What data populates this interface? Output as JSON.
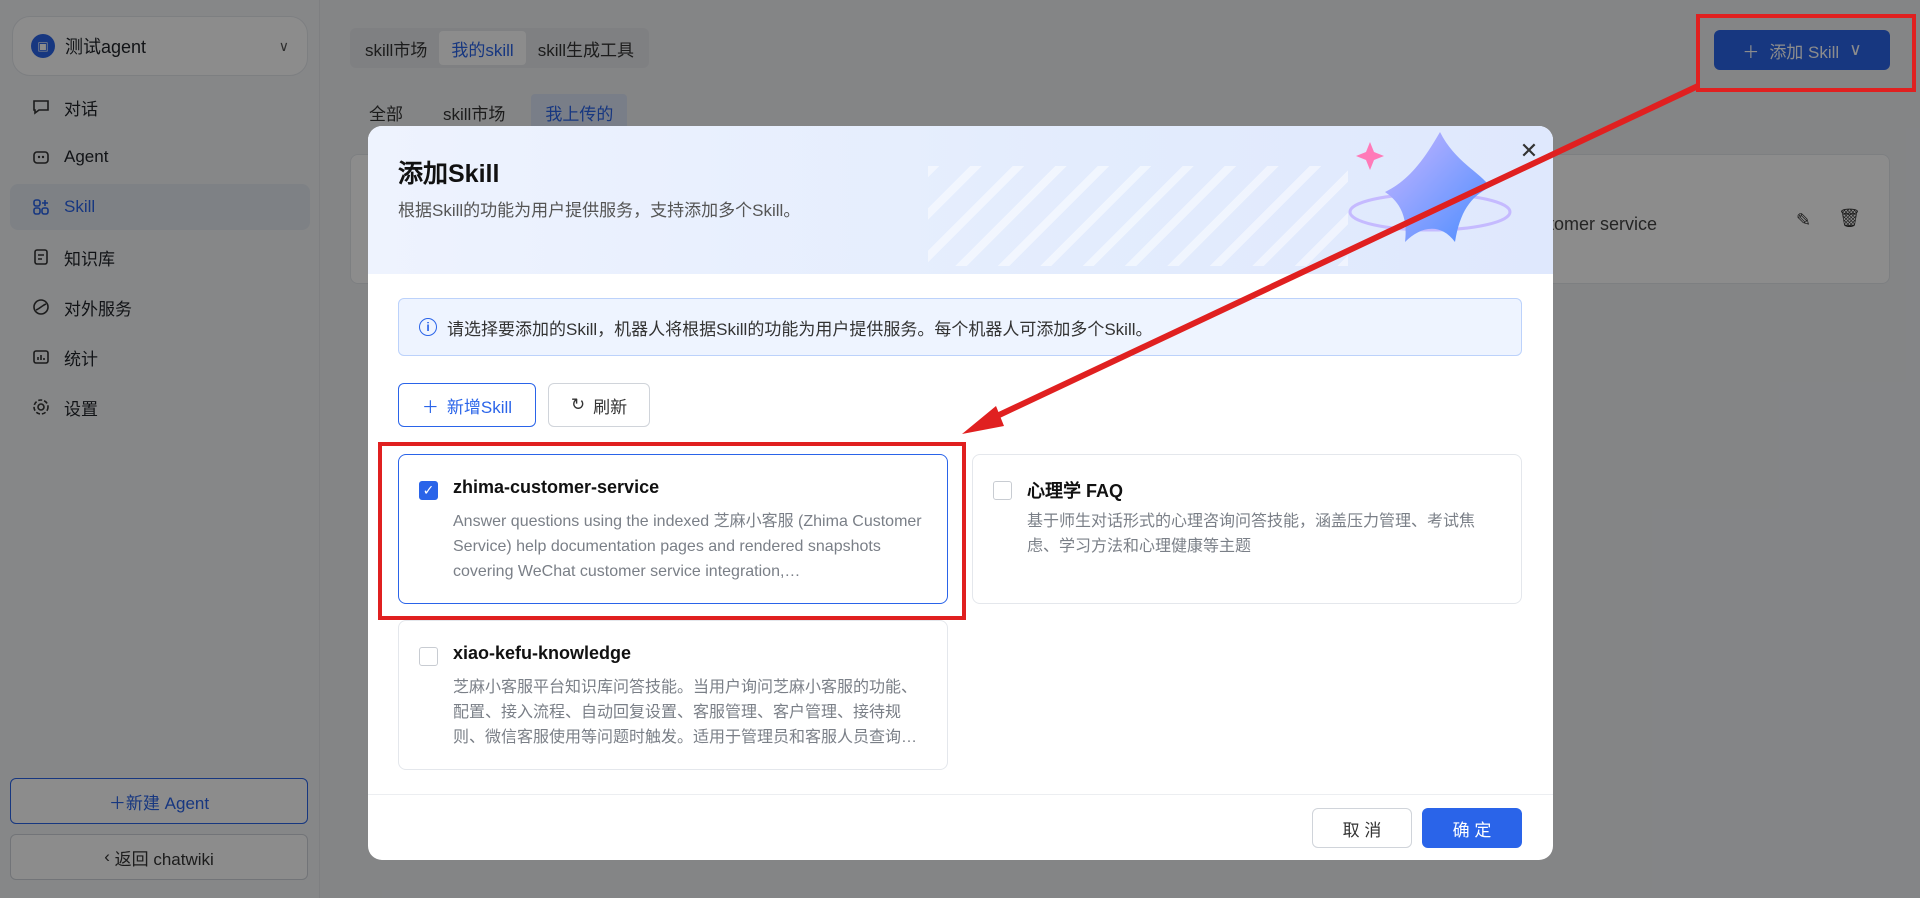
{
  "sidebar": {
    "agent_name": "测试agent",
    "items": [
      {
        "label": "对话",
        "icon": "chat-icon"
      },
      {
        "label": "Agent",
        "icon": "agent-icon"
      },
      {
        "label": "Skill",
        "icon": "skill-icon"
      },
      {
        "label": "知识库",
        "icon": "knowledge-icon"
      },
      {
        "label": "对外服务",
        "icon": "service-icon"
      },
      {
        "label": "统计",
        "icon": "stats-icon"
      },
      {
        "label": "设置",
        "icon": "settings-icon"
      }
    ],
    "active_item": "Skill",
    "new_agent_label": "新建 Agent",
    "back_label": "返回 chatwiki"
  },
  "main": {
    "top_tabs": [
      "skill市场",
      "我的skill",
      "skill生成工具"
    ],
    "top_tab_active": "我的skill",
    "sub_tabs": [
      "全部",
      "skill市场",
      "我上传的"
    ],
    "sub_tab_active": "我上传的",
    "add_skill_label": "添加 Skill",
    "bg_card_text": "ustomer service"
  },
  "modal": {
    "title": "添加Skill",
    "subtitle": "根据Skill的功能为用户提供服务，支持添加多个Skill。",
    "info_text": "请选择要添加的Skill，机器人将根据Skill的功能为用户提供服务。每个机器人可添加多个Skill。",
    "new_skill_label": "新增Skill",
    "refresh_label": "刷新",
    "cards": [
      {
        "title": "zhima-customer-service",
        "checked": true,
        "desc": "Answer questions using the indexed 芝麻小客服 (Zhima Customer Service) help documentation pages and rendered snapshots covering WeChat customer service integration,…"
      },
      {
        "title": "心理学 FAQ",
        "checked": false,
        "desc": "基于师生对话形式的心理咨询问答技能，涵盖压力管理、考试焦虑、学习方法和心理健康等主题"
      },
      {
        "title": "xiao-kefu-knowledge",
        "checked": false,
        "desc": "芝麻小客服平台知识库问答技能。当用户询问芝麻小客服的功能、配置、接入流程、自动回复设置、客服管理、客户管理、接待规则、微信客服使用等问题时触发。适用于管理员和客服人员查询…"
      }
    ],
    "cancel_label": "取 消",
    "ok_label": "确 定"
  },
  "colors": {
    "accent": "#2a64e9",
    "annotation": "#e02020"
  }
}
